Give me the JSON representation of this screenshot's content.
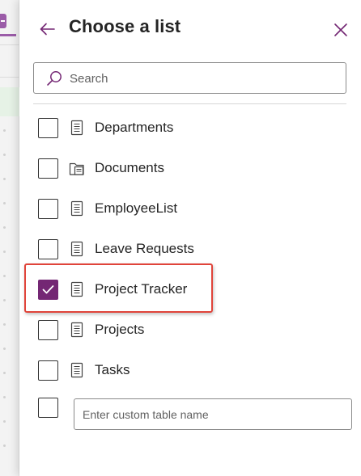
{
  "panel": {
    "title": "Choose a list"
  },
  "search": {
    "placeholder": "Search"
  },
  "lists": [
    {
      "label": "Departments",
      "icon": "list-icon",
      "checked": false
    },
    {
      "label": "Documents",
      "icon": "document-library-icon",
      "checked": false
    },
    {
      "label": "EmployeeList",
      "icon": "list-icon",
      "checked": false
    },
    {
      "label": "Leave Requests",
      "icon": "list-icon",
      "checked": false
    },
    {
      "label": "Project Tracker",
      "icon": "list-icon",
      "checked": true
    },
    {
      "label": "Projects",
      "icon": "list-icon",
      "checked": false
    },
    {
      "label": "Tasks",
      "icon": "list-icon",
      "checked": false
    }
  ],
  "custom_table": {
    "placeholder": "Enter custom table name",
    "checked": false
  },
  "colors": {
    "accent": "#742774",
    "highlight": "#e0443a"
  }
}
